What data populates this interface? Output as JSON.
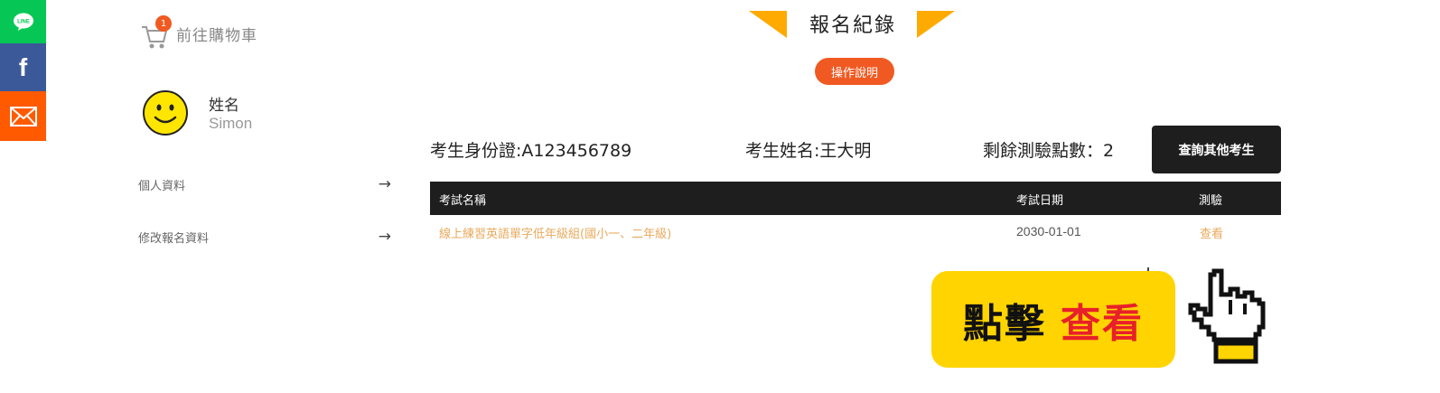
{
  "social": {
    "line_label": "LINE",
    "facebook_label": "f"
  },
  "sidebar": {
    "cart_label": "前往購物車",
    "cart_count": "1",
    "profile_name": "姓名",
    "profile_user": "Simon",
    "items": [
      {
        "label": "個人資料",
        "arrow": "→"
      },
      {
        "label": "修改報名資料",
        "arrow": "→"
      }
    ]
  },
  "header": {
    "title": "報名紀錄",
    "help_label": "操作說明"
  },
  "info": {
    "id_text": "考生身份證:A123456789",
    "name_text": "考生姓名:王大明",
    "points_text": "剩餘測驗點數：2",
    "query_label": "查詢其他考生"
  },
  "table": {
    "headers": {
      "name": "考試名稱",
      "date": "考試日期",
      "test": "測驗"
    },
    "rows": [
      {
        "name": "線上練習英語單字低年級組(國小一、二年級)",
        "date": "2030-01-01",
        "action": "查看"
      }
    ]
  },
  "callout": {
    "text_a": "點擊",
    "text_b": "查看"
  },
  "colors": {
    "accent": "#f05a22",
    "dark": "#1e1e1e",
    "link": "#e8a95c",
    "callout_bg": "#ffd400",
    "callout_red": "#e8202a",
    "triangle": "#ffaa00"
  }
}
